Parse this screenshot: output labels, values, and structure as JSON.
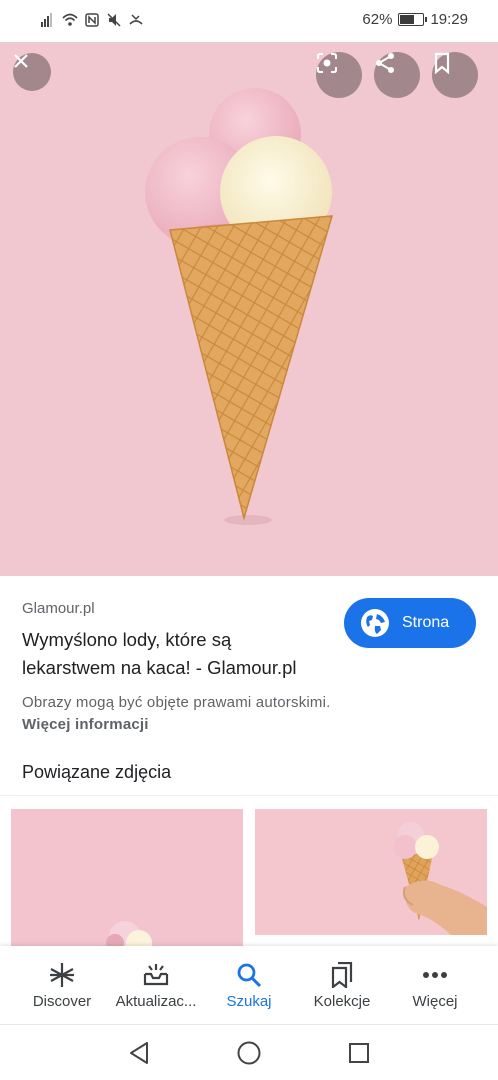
{
  "status_bar": {
    "battery": "62%",
    "time": "19:29",
    "battery_level": 0.62
  },
  "hero": {
    "close_icon": "close-icon",
    "lens_icon": "lens-icon",
    "share_icon": "share-icon",
    "bookmark_icon": "bookmark-icon"
  },
  "result": {
    "source": "Glamour.pl",
    "title": "Wymyślono lody, które są lekarstwem na kaca! - Glamour.pl",
    "visit_label": "Strona",
    "copyright": "Obrazy mogą być objęte prawami autorskimi.",
    "more_info": "Więcej informacji",
    "related_heading": "Powiązane zdjęcia"
  },
  "bottom_nav": {
    "items": [
      {
        "label": "Discover",
        "icon": "asterisk-icon"
      },
      {
        "label": "Aktualizac...",
        "icon": "updates-icon"
      },
      {
        "label": "Szukaj",
        "icon": "search-icon",
        "active": true
      },
      {
        "label": "Kolekcje",
        "icon": "collections-icon"
      },
      {
        "label": "Więcej",
        "icon": "more-icon"
      }
    ]
  },
  "colors": {
    "accent": "#1a73e8",
    "hero_bg": "#f1c8cf",
    "cone": "#e0a45e"
  }
}
